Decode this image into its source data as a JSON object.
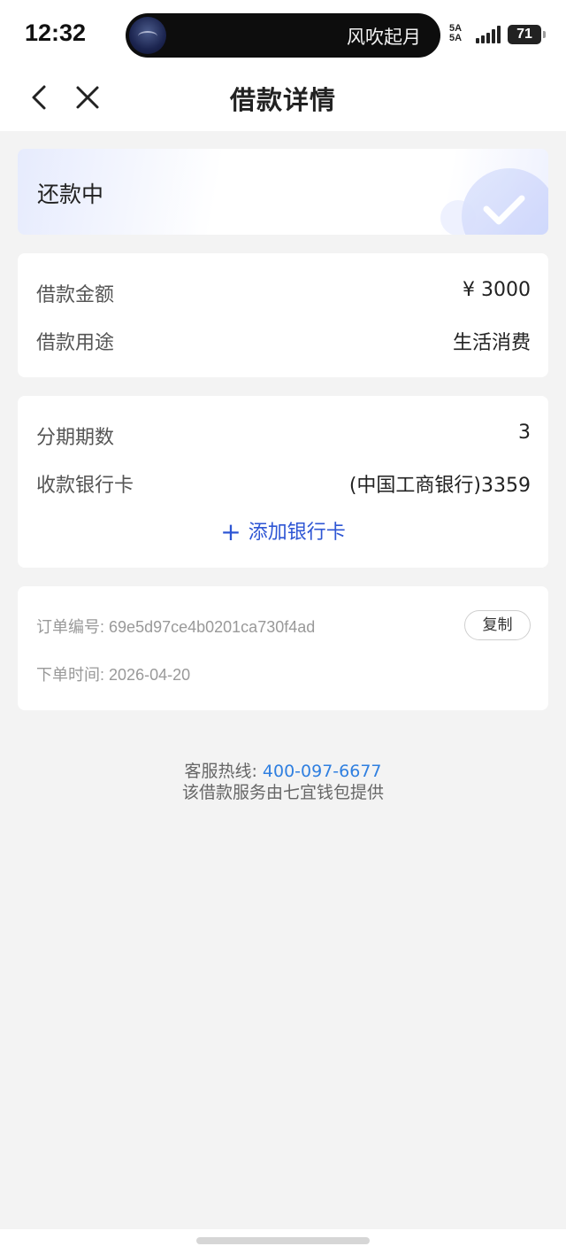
{
  "status_bar": {
    "time": "12:32",
    "now_playing": "风吹起月",
    "network_label": "5A 5A",
    "battery": "71"
  },
  "nav": {
    "title": "借款详情"
  },
  "status_card": {
    "status": "还款中"
  },
  "loan_card": {
    "amount_label": "借款金额",
    "amount_value": "¥ 3000",
    "purpose_label": "借款用途",
    "purpose_value": "生活消费"
  },
  "installment_card": {
    "periods_label": "分期期数",
    "periods_value": "3",
    "bank_label": "收款银行卡",
    "bank_value": "(中国工商银行)3359",
    "add_bank_label": "添加银行卡"
  },
  "order_card": {
    "order_no_label": "订单编号:",
    "order_no_value": "69e5d97ce4b0201ca730f4ad",
    "copy_label": "复制",
    "order_time_label": "下单时间:",
    "order_time_value": "2026-04-20"
  },
  "footer": {
    "hotline_label": "客服热线:",
    "hotline_number": "400-097-6677",
    "provider_text": "该借款服务由七宜钱包提供"
  },
  "colors": {
    "accent": "#2e56d4",
    "phone_link": "#2f7fe0",
    "background": "#f3f3f3"
  }
}
